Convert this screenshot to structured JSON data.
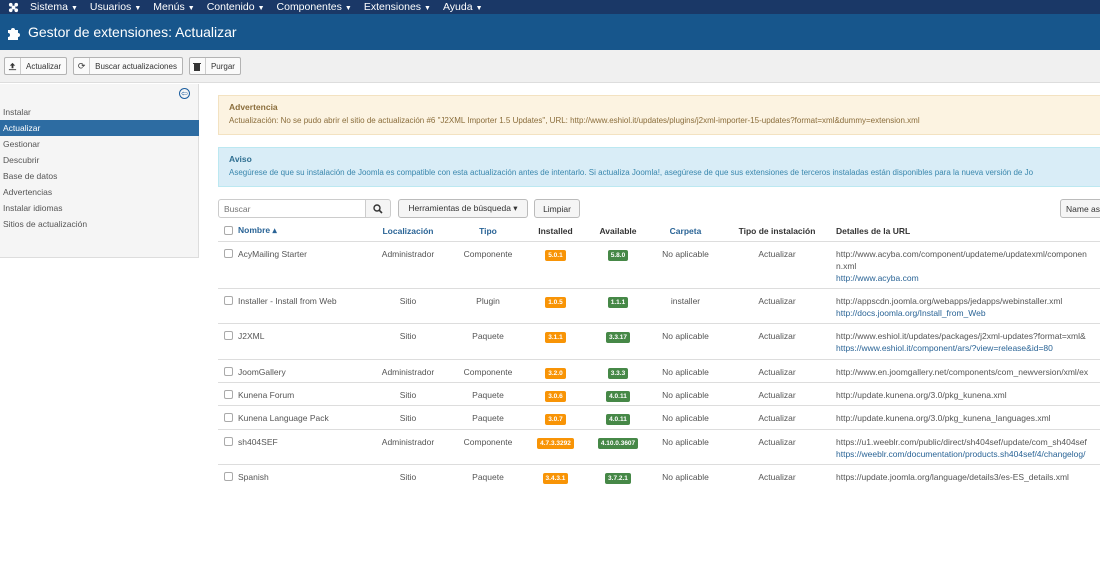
{
  "topnav": {
    "menus": [
      "Sistema",
      "Usuarios",
      "Menús",
      "Contenido",
      "Componentes",
      "Extensiones",
      "Ayuda"
    ]
  },
  "header": {
    "title": "Gestor de extensiones: Actualizar"
  },
  "toolbar": {
    "update": "Actualizar",
    "find": "Buscar actualizaciones",
    "purge": "Purgar"
  },
  "sidebar": {
    "items": [
      "Instalar",
      "Actualizar",
      "Gestionar",
      "Descubrir",
      "Base de datos",
      "Advertencias",
      "Instalar idiomas",
      "Sitios de actualización"
    ],
    "active_index": 1
  },
  "alerts": {
    "warning": {
      "heading": "Advertencia",
      "text": "Actualización: No se pudo abrir el sitio de actualización #6 \"J2XML Importer 1.5 Updates\", URL: http://www.eshiol.it/updates/plugins/j2xml-importer-15-updates?format=xml&dummy=extension.xml"
    },
    "info": {
      "heading": "Aviso",
      "text": "Asegúrese de que su instalación de Joomla es compatible con esta actualización antes de intentarlo. Si actualiza Joomla!, asegúrese de que sus extensiones de terceros instaladas están disponibles para la nueva versión de Jo"
    }
  },
  "filters": {
    "search_placeholder": "Buscar",
    "tools_label": "Herramientas de búsqueda ▾",
    "clear_label": "Limpiar",
    "sort_label": "Name as"
  },
  "table": {
    "headers": {
      "name": "Nombre ▴",
      "location": "Localización",
      "type": "Tipo",
      "installed": "Installed",
      "available": "Available",
      "folder": "Carpeta",
      "install_type": "Tipo de instalación",
      "details": "Detalles de la URL"
    },
    "rows": [
      {
        "name": "AcyMailing Starter",
        "location": "Administrador",
        "type": "Componente",
        "installed": "5.0.1",
        "available": "5.8.0",
        "folder": "No aplicable",
        "install_type": "Actualizar",
        "url1": "http://www.acyba.com/component/updateme/updatexml/componen",
        "url2": "n.xml",
        "link": "http://www.acyba.com"
      },
      {
        "name": "Installer - Install from Web",
        "location": "Sitio",
        "type": "Plugin",
        "installed": "1.0.5",
        "available": "1.1.1",
        "folder": "installer",
        "install_type": "Actualizar",
        "url1": "http://appscdn.joomla.org/webapps/jedapps/webinstaller.xml",
        "url2": "",
        "link": "http://docs.joomla.org/Install_from_Web"
      },
      {
        "name": "J2XML",
        "location": "Sitio",
        "type": "Paquete",
        "installed": "3.1.1",
        "available": "3.3.17",
        "folder": "No aplicable",
        "install_type": "Actualizar",
        "url1": "http://www.eshiol.it/updates/packages/j2xml-updates?format=xml&",
        "url2": "",
        "link": "https://www.eshiol.it/component/ars/?view=release&id=80"
      },
      {
        "name": "JoomGallery",
        "location": "Administrador",
        "type": "Componente",
        "installed": "3.2.0",
        "available": "3.3.3",
        "folder": "No aplicable",
        "install_type": "Actualizar",
        "url1": "http://www.en.joomgallery.net/components/com_newversion/xml/ex",
        "url2": "",
        "link": ""
      },
      {
        "name": "Kunena Forum",
        "location": "Sitio",
        "type": "Paquete",
        "installed": "3.0.6",
        "available": "4.0.11",
        "folder": "No aplicable",
        "install_type": "Actualizar",
        "url1": "http://update.kunena.org/3.0/pkg_kunena.xml",
        "url2": "",
        "link": ""
      },
      {
        "name": "Kunena Language Pack",
        "location": "Sitio",
        "type": "Paquete",
        "installed": "3.0.7",
        "available": "4.0.11",
        "folder": "No aplicable",
        "install_type": "Actualizar",
        "url1": "http://update.kunena.org/3.0/pkg_kunena_languages.xml",
        "url2": "",
        "link": ""
      },
      {
        "name": "sh404SEF",
        "location": "Administrador",
        "type": "Componente",
        "installed": "4.7.3.3292",
        "available": "4.10.0.3607",
        "folder": "No aplicable",
        "install_type": "Actualizar",
        "url1": "https://u1.weeblr.com/public/direct/sh404sef/update/com_sh404sef",
        "url2": "",
        "link": "https://weeblr.com/documentation/products.sh404sef/4/changelog/"
      },
      {
        "name": "Spanish",
        "location": "Sitio",
        "type": "Paquete",
        "installed": "3.4.3.1",
        "available": "3.7.2.1",
        "folder": "No aplicable",
        "install_type": "Actualizar",
        "url1": "https://update.joomla.org/language/details3/es-ES_details.xml",
        "url2": "",
        "link": ""
      }
    ]
  },
  "colors": {
    "nav": "#1a3867",
    "header": "#17568c",
    "badge_installed": "#f89406",
    "badge_available": "#468847"
  }
}
